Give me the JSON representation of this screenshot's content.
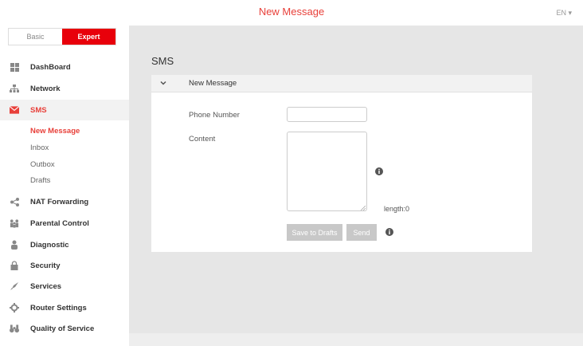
{
  "header": {
    "title": "New Message",
    "language": "EN ▾"
  },
  "mode": {
    "basic": "Basic",
    "expert": "Expert"
  },
  "sidebar": {
    "items": [
      {
        "label": "DashBoard",
        "icon": "dashboard-icon"
      },
      {
        "label": "Network",
        "icon": "network-icon"
      },
      {
        "label": "SMS",
        "icon": "envelope-icon"
      },
      {
        "label": "NAT Forwarding",
        "icon": "share-icon"
      },
      {
        "label": "Parental Control",
        "icon": "family-icon"
      },
      {
        "label": "Diagnostic",
        "icon": "diagnostic-icon"
      },
      {
        "label": "Security",
        "icon": "lock-icon"
      },
      {
        "label": "Services",
        "icon": "rocket-icon"
      },
      {
        "label": "Router Settings",
        "icon": "gear-icon"
      },
      {
        "label": "Quality of Service",
        "icon": "binoculars-icon"
      }
    ],
    "sms_sub": [
      "New Message",
      "Inbox",
      "Outbox",
      "Drafts"
    ]
  },
  "main": {
    "section_title": "SMS",
    "panel_title": "New Message",
    "phone_label": "Phone Number",
    "phone_value": "",
    "content_label": "Content",
    "content_value": "",
    "length_text": "length:0",
    "save_drafts": "Save to Drafts",
    "send": "Send"
  },
  "colors": {
    "accent": "#e8403a",
    "expert_bg": "#e8000b",
    "main_bg": "#e6e6e6",
    "disabled_btn": "#c8c8c8"
  }
}
